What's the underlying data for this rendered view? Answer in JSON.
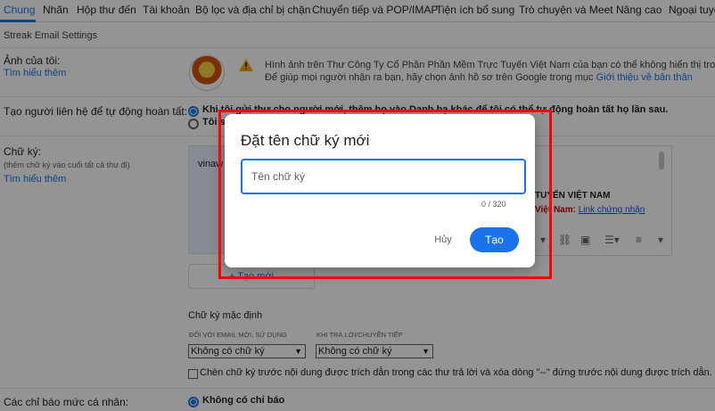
{
  "tabs": [
    {
      "label": "Chung",
      "active": true
    },
    {
      "label": "Nhãn"
    },
    {
      "label": "Hộp thư đến"
    },
    {
      "label": "Tài khoản"
    },
    {
      "label": "Bộ lọc và địa chỉ bị chặn"
    },
    {
      "label": "Chuyển tiếp và POP/IMAP"
    },
    {
      "label": "Tiện ích bổ sung"
    },
    {
      "label": "Trò chuyện và Meet"
    },
    {
      "label": "Nâng cao"
    },
    {
      "label": "Ngoại tuyến"
    }
  ],
  "streak_title": "Streak Email Settings",
  "my_picture": {
    "label": "Ảnh của tôi:",
    "learn_more": "Tìm hiểu thêm",
    "notice_line1": "Hình ảnh trên Thư Công Ty Cổ Phần Phần Mềm Trực Tuyến Việt Nam của bạn có thể không hiển thị trong",
    "notice_line2_prefix": "Để giúp mọi người nhận ra bạn, hãy chọn ảnh hồ sơ trên Google trong mục ",
    "notice_line2_link": "Giới thiệu về bản thân"
  },
  "auto_contacts": {
    "label": "Tạo người liên hệ để tự động hoàn tất:",
    "option1": "Khi tôi gửi thư cho người mới, thêm họ vào Danh bạ khác để tôi có thể tự động hoàn tất họ lần sau.",
    "option2": "Tôi sẽ tự thêm người liên hệ"
  },
  "signature": {
    "label": "Chữ ký:",
    "sublabel": "(thêm chữ ký vào cuối tất cả thư đi)",
    "learn_more": "Tìm hiểu thêm",
    "list_item": "vinaw",
    "editor_company": "TUYẾN VIỆT NAM",
    "editor_prefix": "Việt Nam:",
    "editor_link": "Link chứng nhận",
    "new_button": "+ Tạo mới"
  },
  "defaults": {
    "title": "Chữ ký mặc định",
    "new_email_caption": "ĐỐI VỚI EMAIL MỚI, SỬ DỤNG",
    "reply_caption": "KHI TRẢ LỜI/CHUYỂN TIẾP",
    "new_email_value": "Không có chữ ký",
    "reply_value": "Không có chữ ký",
    "insert_before_quote": "Chèn chữ ký trước nội dung được trích dẫn trong các thư trả lời và xóa dòng \"--\" đứng trước nội dung được trích dẫn."
  },
  "personal_indicators": {
    "label": "Các chỉ báo mức cá nhân:",
    "option1": "Không có chỉ báo"
  },
  "dialog": {
    "title": "Đặt tên chữ ký mới",
    "placeholder": "Tên chữ ký",
    "counter": "0 / 320",
    "cancel": "Hủy",
    "create": "Tạo"
  },
  "colors": {
    "accent": "#1a73e8",
    "highlight": "#ff0000"
  }
}
